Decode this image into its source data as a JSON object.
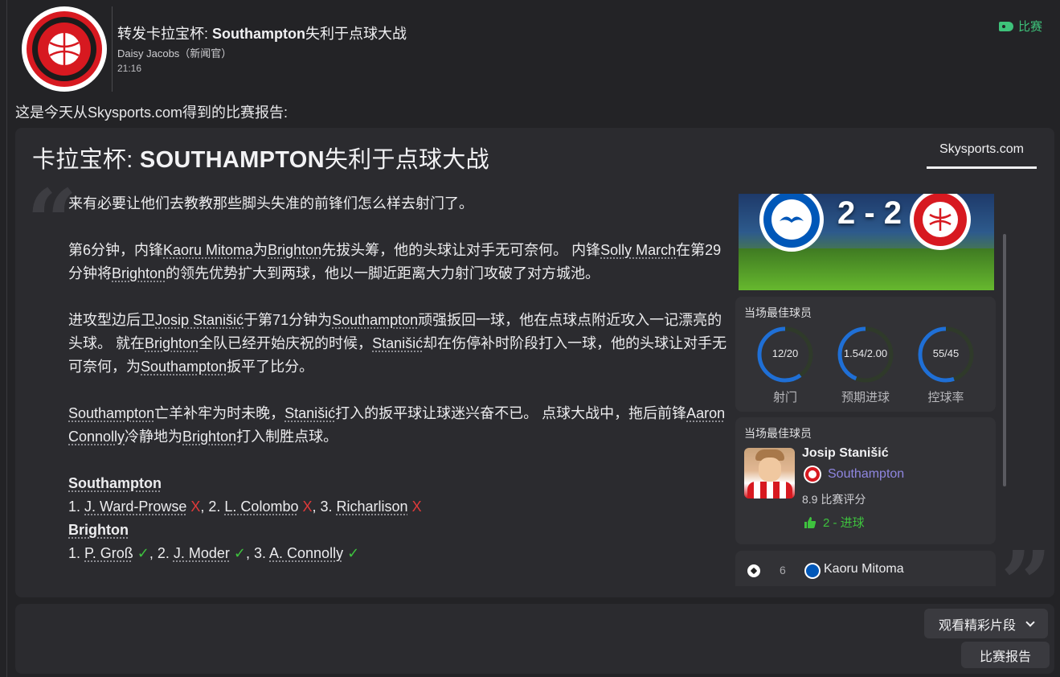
{
  "header": {
    "title_prefix": "转发卡拉宝杯: ",
    "title_bold": "Southampton",
    "title_suffix": "失利于点球大战",
    "author": "Daisy Jacobs（新闻官）",
    "time": "21:16",
    "match_tag": "比赛",
    "tag_color": "#3ec27a"
  },
  "intro": "这是今天从Skysports.com得到的比赛报告:",
  "report": {
    "title_prefix": "卡拉宝杯: ",
    "title_bold": "SOUTHAMPTON",
    "title_suffix": "失利于点球大战",
    "source_tab": "Skysports.com",
    "paragraphs": {
      "p1": "来有必要让他们去教教那些脚头失准的前锋们怎么样去射门了。",
      "p2_a": "第6分钟，内锋",
      "p2_player1": "Kaoru Mitoma",
      "p2_b": "为",
      "p2_team1": "Brighton",
      "p2_c": "先拔头筹，他的头球让对手无可奈何。 内锋",
      "p2_player2": "Solly March",
      "p2_d": "在第29分钟将",
      "p2_team2": "Brighton",
      "p2_e": "的领先优势扩大到两球，他以一脚近距离大力射门攻破了对方城池。",
      "p3_a": "进攻型边后卫",
      "p3_player1": "Josip Stanišić",
      "p3_b": "于第71分钟为",
      "p3_team1": "Southampton",
      "p3_c": "顽强扳回一球，他在点球点附近攻入一记漂亮的头球。 就在",
      "p3_team2": "Brighton",
      "p3_d": "全队已经开始庆祝的时候，",
      "p3_player2": "Stanišić",
      "p3_e": "却在伤停补时阶段打入一球，他的头球让对手无可奈何，为",
      "p3_team3": "Southampton",
      "p3_f": "扳平了比分。",
      "p4_team1": "Southampton",
      "p4_a": "亡羊补牢为时未晚，",
      "p4_player1": "Stanišić",
      "p4_b": "打入的扳平球让球迷兴奋不已。 点球大战中，拖后前锋",
      "p4_player2": "Aaron Connolly",
      "p4_c": "冷静地为",
      "p4_team2": "Brighton",
      "p4_d": "打入制胜点球。"
    },
    "shootout": {
      "team1": "Southampton",
      "team1_kicks": [
        {
          "prefix": "1. ",
          "name": "J. Ward-Prowse",
          "mark": "X"
        },
        {
          "prefix": ", 2. ",
          "name": "L. Colombo",
          "mark": "X"
        },
        {
          "prefix": ", 3. ",
          "name": "Richarlison",
          "mark": "X"
        }
      ],
      "team2": "Brighton",
      "team2_kicks": [
        {
          "prefix": "1. ",
          "name": "P. Groß",
          "mark": "✓"
        },
        {
          "prefix": ", 2. ",
          "name": "J. Moder",
          "mark": "✓"
        },
        {
          "prefix": ", 3. ",
          "name": "A. Connolly",
          "mark": "✓"
        }
      ]
    }
  },
  "sidebar": {
    "score": "2 - 2",
    "stats_title": "当场最佳球员",
    "stats": [
      {
        "value": "12/20",
        "label": "射门",
        "fraction": 0.6
      },
      {
        "value": "1.54/2.00",
        "label": "预期进球",
        "fraction": 0.44
      },
      {
        "value": "55/45",
        "label": "控球率",
        "fraction": 0.55
      }
    ],
    "motm_title": "当场最佳球员",
    "motm_name": "Josip Stanišić",
    "motm_club": "Southampton",
    "motm_rating": "8.9  比赛评分",
    "motm_goals": "2 - 进球",
    "event_minute": "6",
    "event_player": "Kaoru Mitoma",
    "accent_blue": "#1f6fd6",
    "accent_green": "#3ec23e",
    "accent_red": "#e03a3a"
  },
  "footer": {
    "highlights_label": "观看精彩片段",
    "report_label": "比赛报告"
  }
}
